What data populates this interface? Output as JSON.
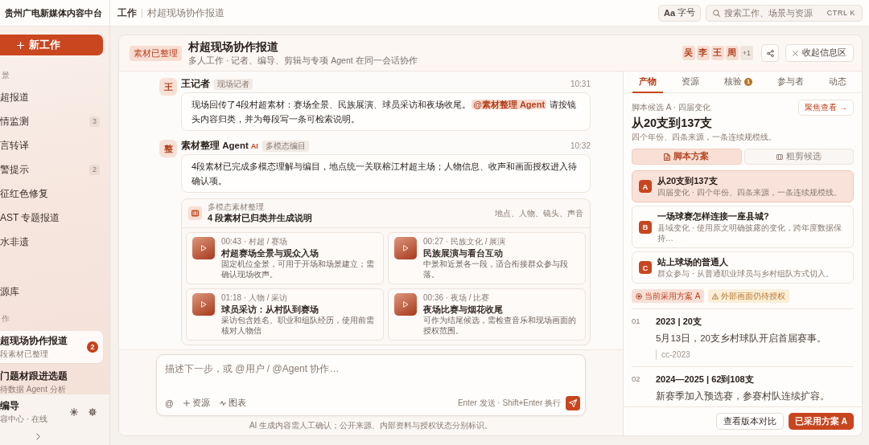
{
  "sidebar": {
    "brand": "贵州广电新媒体内容中台",
    "new_button": "新工作",
    "scenes": {
      "label": "景",
      "items": [
        {
          "label": "超报道",
          "selected": false
        },
        {
          "label": "情监测",
          "count": "3",
          "selected": false
        },
        {
          "label": "言转译",
          "selected": false
        },
        {
          "label": "警提示",
          "count": "2",
          "selected": false
        },
        {
          "label": "征红色修复",
          "selected": false
        },
        {
          "label": "AST 专题报道",
          "selected": false
        },
        {
          "label": "水非遗",
          "selected": false
        }
      ]
    },
    "library": "源库",
    "works": {
      "label": "作",
      "items": [
        {
          "title": "超现场协作报道",
          "subtitle": "段素材已整理",
          "count": "2",
          "selected": true
        },
        {
          "title": "门题材跟进选题",
          "subtitle": "待数据 Agent 分析",
          "selected": false
        }
      ]
    },
    "user": {
      "name": "编导",
      "status": "容中心 · 在线"
    }
  },
  "topbar": {
    "breadcrumb": [
      "工作",
      "村超现场协作报道"
    ],
    "font_button": {
      "glyph": "Aa",
      "label": "字号"
    },
    "search": {
      "placeholder": "搜索工作、场景与资源",
      "shortcut": "CTRL K"
    }
  },
  "work": {
    "status": "素材已整理",
    "title": "村超现场协作报道",
    "subtitle": "多人工作 · 记者、编导、剪辑与专项 Agent 在同一会话协作",
    "participants": [
      "吴",
      "李",
      "王",
      "周"
    ],
    "more": "+1",
    "collapse_button": "收起信息区"
  },
  "messages": [
    {
      "avatar": "王",
      "author": "王记者",
      "role": "现场记者",
      "time": "10:31",
      "body": [
        {
          "kind": "text",
          "text": "现场回传了4段村超素材：赛场全景、民族展演、球员采访和夜场收尾。"
        },
        {
          "kind": "mention",
          "text": "@素材整理 Agent"
        },
        {
          "kind": "text",
          "text": "请按镜头内容归类，并为每段写一条可检索说明。"
        }
      ]
    },
    {
      "avatar": "整",
      "author": "素材整理 Agent",
      "ai_badge": "AI",
      "role": "多模态编目",
      "time": "10:32",
      "body": [
        {
          "kind": "text",
          "text": "4段素材已完成多模态理解与编目，地点统一关联榕江村超主场；人物信息、收声和画面授权进入待确认项。"
        }
      ],
      "attachment": {
        "label": "多模态素材整理",
        "title": "4 段素材已归类并生成说明",
        "tags": "地点、人物、镜头、声音",
        "clips": [
          {
            "meta": "00:43 · 村超 / 赛场",
            "title": "村超赛场全景与观众入场",
            "description": "固定机位全景，可用于开场和场景建立；需确认现场收声。"
          },
          {
            "meta": "00:27 · 民族文化 / 展演",
            "title": "民族展演与看台互动",
            "description": "中景和近景各一段，适合衔接群众参与段落。"
          },
          {
            "meta": "01:18 · 人物 / 采访",
            "title": "球员采访：从村队到赛场",
            "description": "采访包含姓名、职业和组队经历，使用前需核对人物信"
          },
          {
            "meta": "00:36 · 夜场 / 比赛",
            "title": "夜场比赛与烟花收尾",
            "description": "可作为结尾候选，需检查音乐和现场画面的授权范围。"
          }
        ]
      }
    }
  ],
  "composer": {
    "placeholder": "描述下一步，或 @用户 / @Agent 协作…",
    "tools": [
      {
        "kind": "mention",
        "label": "@"
      },
      {
        "kind": "resource",
        "label": "资源"
      },
      {
        "kind": "chart",
        "label": "图表"
      }
    ],
    "hint": "Enter 发送 · Shift+Enter 换行",
    "disclaimer": "AI 生成内容需人工确认；公开来源、内部资料与授权状态分别标识。"
  },
  "panel": {
    "tabs": [
      {
        "label": "产物",
        "selected": true
      },
      {
        "label": "资源",
        "selected": false
      },
      {
        "label": "核验",
        "badge": "1",
        "selected": false
      },
      {
        "label": "参与者",
        "selected": false
      },
      {
        "label": "动态",
        "selected": false
      }
    ],
    "eyebrow": "脚本候选 A · 四届变化",
    "focus_button": "聚焦查看 →",
    "title": "从20支到137支",
    "summary": "四个年份、四条来源，一条连续规模线。",
    "modes": [
      {
        "kind": "script",
        "label": "脚本方案",
        "selected": true
      },
      {
        "kind": "rough_cut",
        "label": "粗剪候选",
        "selected": false
      }
    ],
    "options": [
      {
        "letter": "A",
        "title": "从20支到137支",
        "description": "四届变化 · 四个年份、四条来源，一条连续规模线。",
        "selected": true
      },
      {
        "letter": "B",
        "title": "一场球赛怎样连接一座县城?",
        "description": "县域变化 · 使用原文明确披露的变化，跨年度数据保持…",
        "selected": false
      },
      {
        "letter": "C",
        "title": "站上球场的普通人",
        "description": "群众参与 · 从普通职业球员与乡村组队方式切入。",
        "selected": false
      }
    ],
    "status_tags": [
      {
        "kind": "current",
        "label": "当前采用方案 A"
      },
      {
        "kind": "warning",
        "label": "外部画面仍待授权"
      }
    ],
    "timeline": [
      {
        "index": "01",
        "heading": "2023 | 20支",
        "text": "5月13日，20支乡村球队开启首届赛事。",
        "sources": [
          "cc-2023"
        ]
      },
      {
        "index": "02",
        "heading": "2024—2025 | 62到108支",
        "text": "新赛季加入预选赛，参赛村队连续扩容。"
      }
    ],
    "actions": [
      {
        "kind": "secondary",
        "label": "查看版本对比"
      },
      {
        "kind": "primary",
        "label": "已采用方案 A"
      }
    ]
  }
}
